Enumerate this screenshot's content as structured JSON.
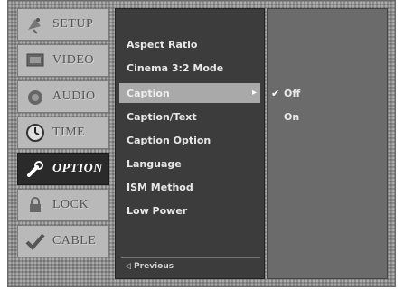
{
  "tabs": [
    {
      "label": "SETUP",
      "icon": "satellite-dish-icon",
      "active": false
    },
    {
      "label": "VIDEO",
      "icon": "tv-screen-icon",
      "active": false
    },
    {
      "label": "AUDIO",
      "icon": "speaker-icon",
      "active": false
    },
    {
      "label": "TIME",
      "icon": "clock-icon",
      "active": false
    },
    {
      "label": "OPTION",
      "icon": "wrench-icon",
      "active": true
    },
    {
      "label": "LOCK",
      "icon": "padlock-icon",
      "active": false
    },
    {
      "label": "CABLE",
      "icon": "checkmark-cable-icon",
      "active": false
    }
  ],
  "menu": {
    "items": [
      {
        "label": "Aspect Ratio"
      },
      {
        "label": "Cinema 3:2 Mode"
      },
      {
        "label": "Caption",
        "selected": true,
        "arrow": "▸"
      },
      {
        "label": "Caption/Text"
      },
      {
        "label": "Caption Option"
      },
      {
        "label": "Language"
      },
      {
        "label": "ISM Method"
      },
      {
        "label": "Low Power"
      }
    ],
    "hint": "◁ Previous"
  },
  "submenu": {
    "options": [
      {
        "label": "Off",
        "check": "✔",
        "selected": true
      },
      {
        "label": "On",
        "check": "",
        "selected": false
      }
    ]
  },
  "colors": {
    "frame": "#8e8e8e",
    "menu_bg": "#3c3c3c",
    "highlight": "#a9a9a9",
    "active_tab": "#2a2a2a"
  }
}
